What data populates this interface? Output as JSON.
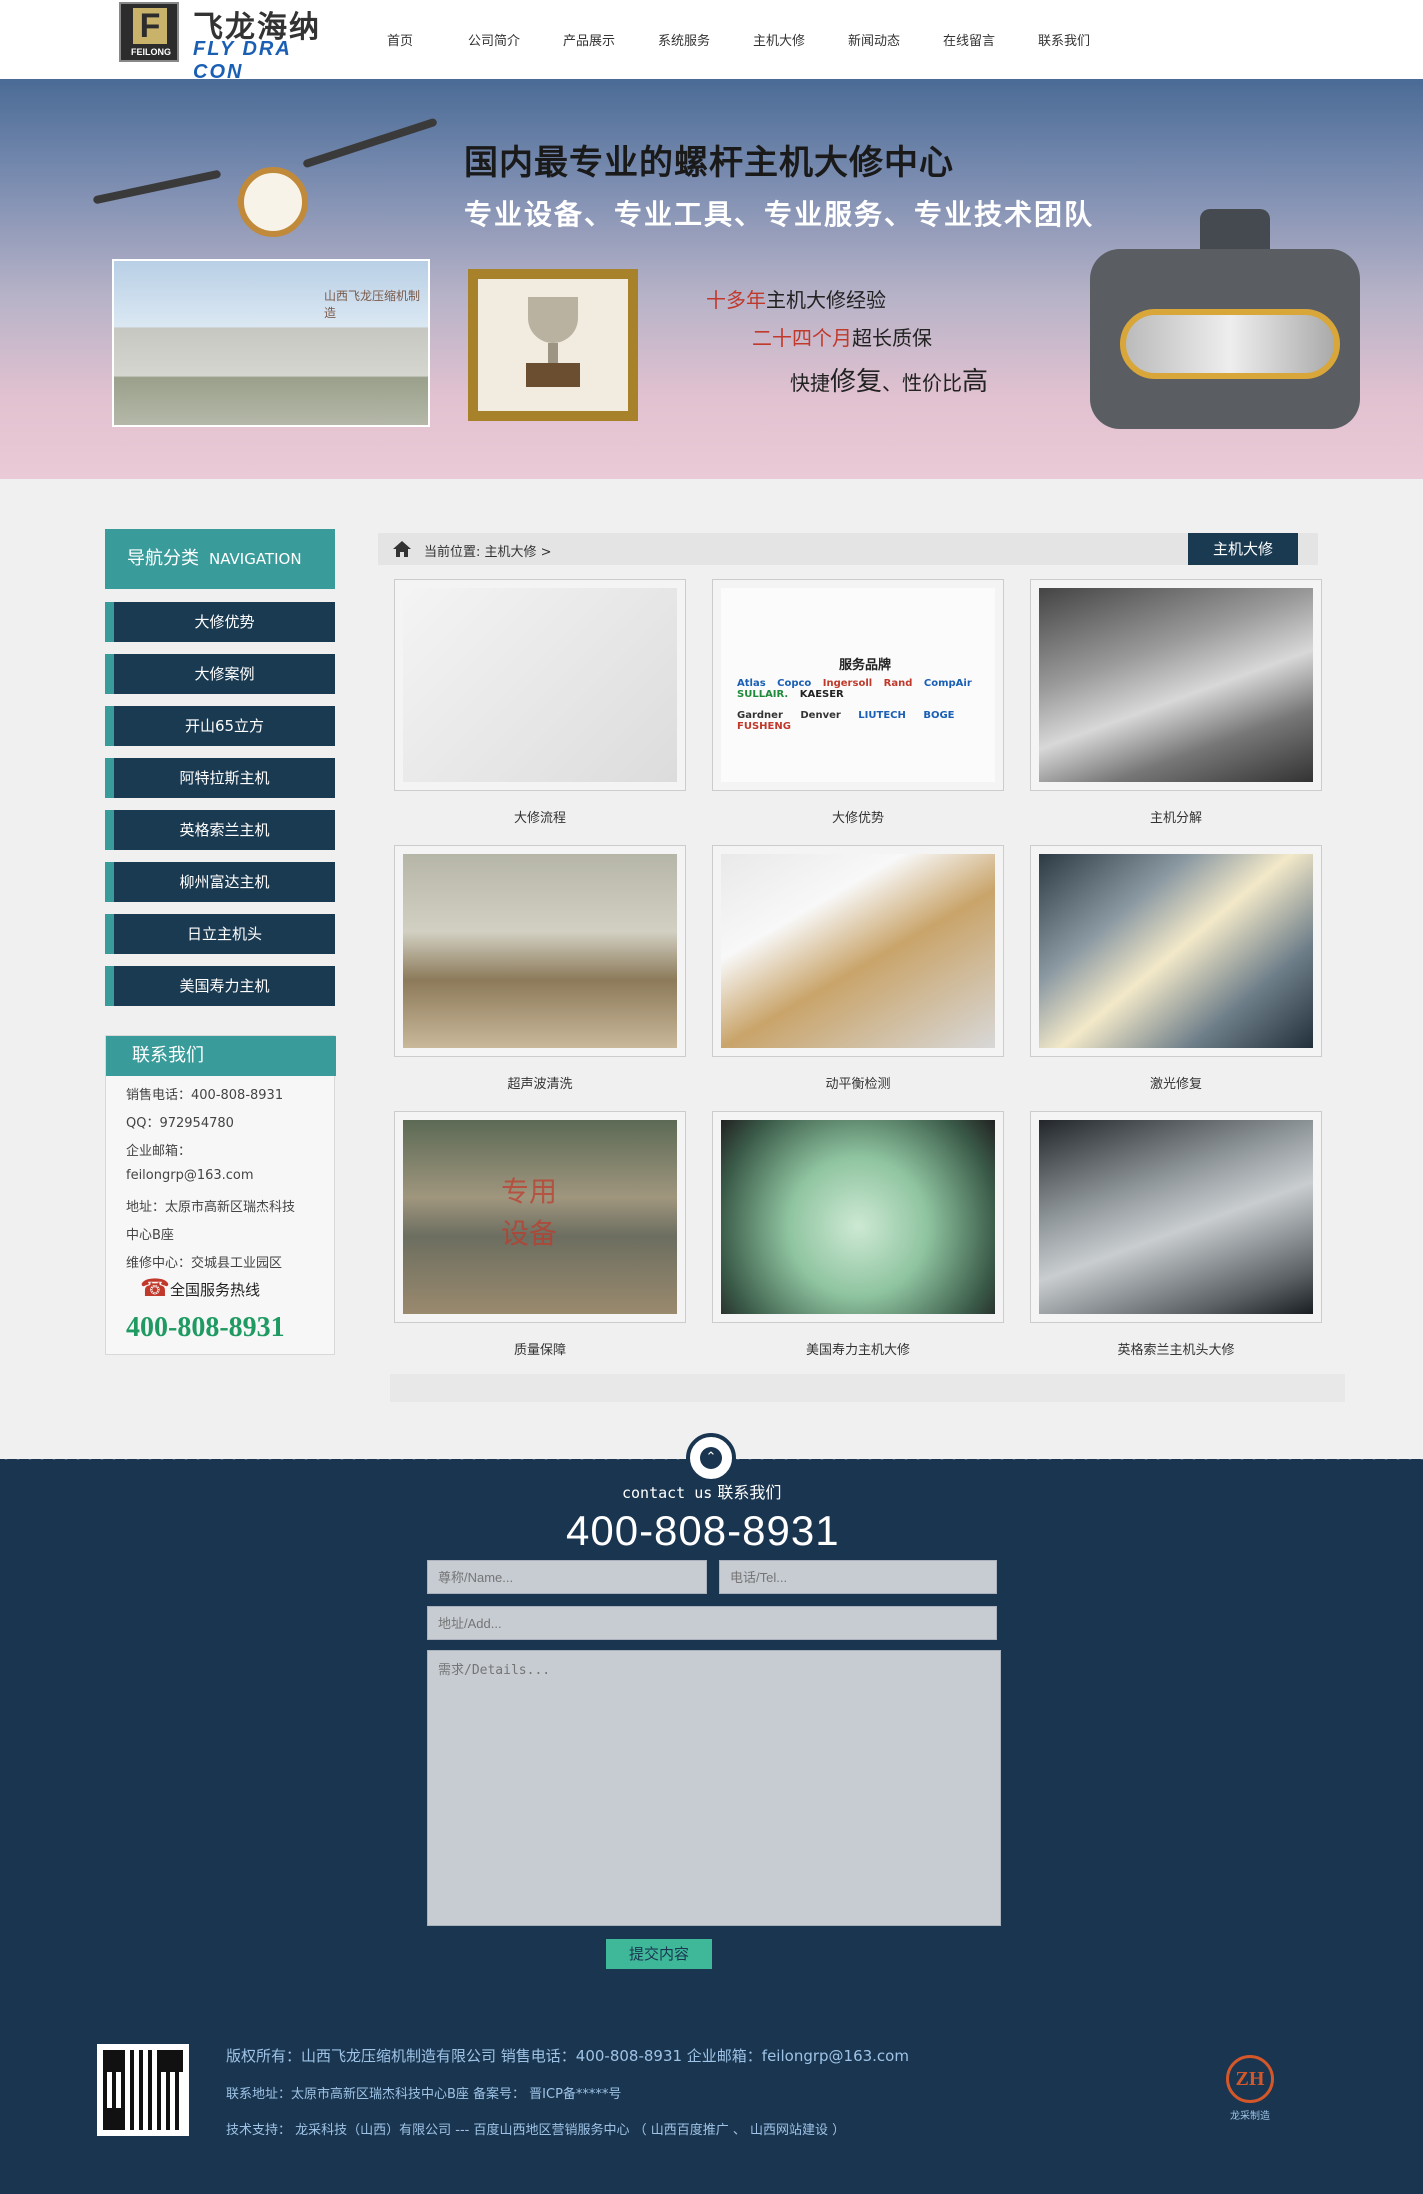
{
  "header": {
    "logo_letter": "F",
    "logo_small": "FEILONG",
    "logo_cn": "飞龙海纳",
    "logo_en": "FLY DRA CON",
    "nav": [
      "首页",
      "公司简介",
      "产品展示",
      "系统服务",
      "主机大修",
      "新闻动态",
      "在线留言",
      "联系我们"
    ]
  },
  "banner": {
    "title": "国内最专业的螺杆主机大修中心",
    "subtitle": "专业设备、专业工具、专业服务、专业技术团队",
    "line1_red": "十多年",
    "line1_rest": "主机大修经验",
    "line2_red": "二十四个月",
    "line2_rest": "超长质保",
    "line3_a": "快捷",
    "line3_b": "修复",
    "line3_c": "、性价比",
    "line3_d": "高",
    "factory_sign": "山西飞龙压缩机制造"
  },
  "sidebar": {
    "heading": "导航分类",
    "heading_en": "NAVIGATION",
    "items": [
      "大修优势",
      "大修案例",
      "开山65立方",
      "阿特拉斯主机",
      "英格索兰主机",
      "柳州富达主机",
      "日立主机头",
      "美国寿力主机"
    ],
    "contact": {
      "heading": "联系我们",
      "sales": "销售电话：400-808-8931",
      "qq": "QQ：972954780",
      "email_label": "企业邮箱：",
      "email": "feilongrp@163.com",
      "address1": "地址：太原市高新区瑞杰科技",
      "address2": "中心B座",
      "repair": "维修中心：交城县工业园区",
      "hotline_label": "全国服务热线",
      "hotline": "400-808-8931"
    }
  },
  "breadcrumb": {
    "prefix": "当前位置:",
    "current": "主机大修 >",
    "tag": "主机大修"
  },
  "gallery": [
    {
      "caption": "大修流程",
      "kind": "flow"
    },
    {
      "caption": "大修优势",
      "kind": "brand"
    },
    {
      "caption": "主机分解",
      "kind": "metal"
    },
    {
      "caption": "超声波清洗",
      "kind": "wash"
    },
    {
      "caption": "动平衡检测",
      "kind": "balance"
    },
    {
      "caption": "激光修复",
      "kind": "laser"
    },
    {
      "caption": "质量保障",
      "kind": "quality"
    },
    {
      "caption": "美国寿力主机大修",
      "kind": "green"
    },
    {
      "caption": "英格索兰主机头大修",
      "kind": "gray"
    }
  ],
  "brand_image": {
    "title": "服务品牌",
    "row1": [
      "Atlas Copco",
      "Ingersoll Rand",
      "CompAir",
      "SULLAIR.",
      "KAESER"
    ],
    "row2": [
      "Gardner Denver",
      "LIUTECH",
      "BOGE",
      "FUSHENG"
    ]
  },
  "quality_image": {
    "text1": "专用",
    "text2": "设备"
  },
  "footer": {
    "up_icon": "⌃",
    "contact_en": "contact us",
    "contact_cn": "联系我们",
    "phone": "400-808-8931",
    "form": {
      "name_placeholder": "尊称/Name...",
      "tel_placeholder": "电话/Tel...",
      "add_placeholder": "地址/Add...",
      "details_placeholder": "需求/Details...",
      "submit": "提交内容"
    },
    "copyright": "版权所有：山西飞龙压缩机制造有限公司  销售电话：400-808-8931 企业邮箱：feilongrp@163.com",
    "address_line": "联系地址：太原市高新区瑞杰科技中心B座 备案号： 晋ICP备*****号",
    "support_line": "技术支持： 龙采科技（山西）有限公司 --- 百度山西地区营销服务中心  （  山西百度推广  、  山西网站建设  ）",
    "brand_mark": "ZH",
    "brand_name": "龙采制造"
  },
  "colors": {
    "teal": "#3a9b9b",
    "navy": "#1a3a52",
    "footer_bg": "#1a3550",
    "hotline_green": "#1f9a62",
    "accent_red": "#c0392b"
  }
}
